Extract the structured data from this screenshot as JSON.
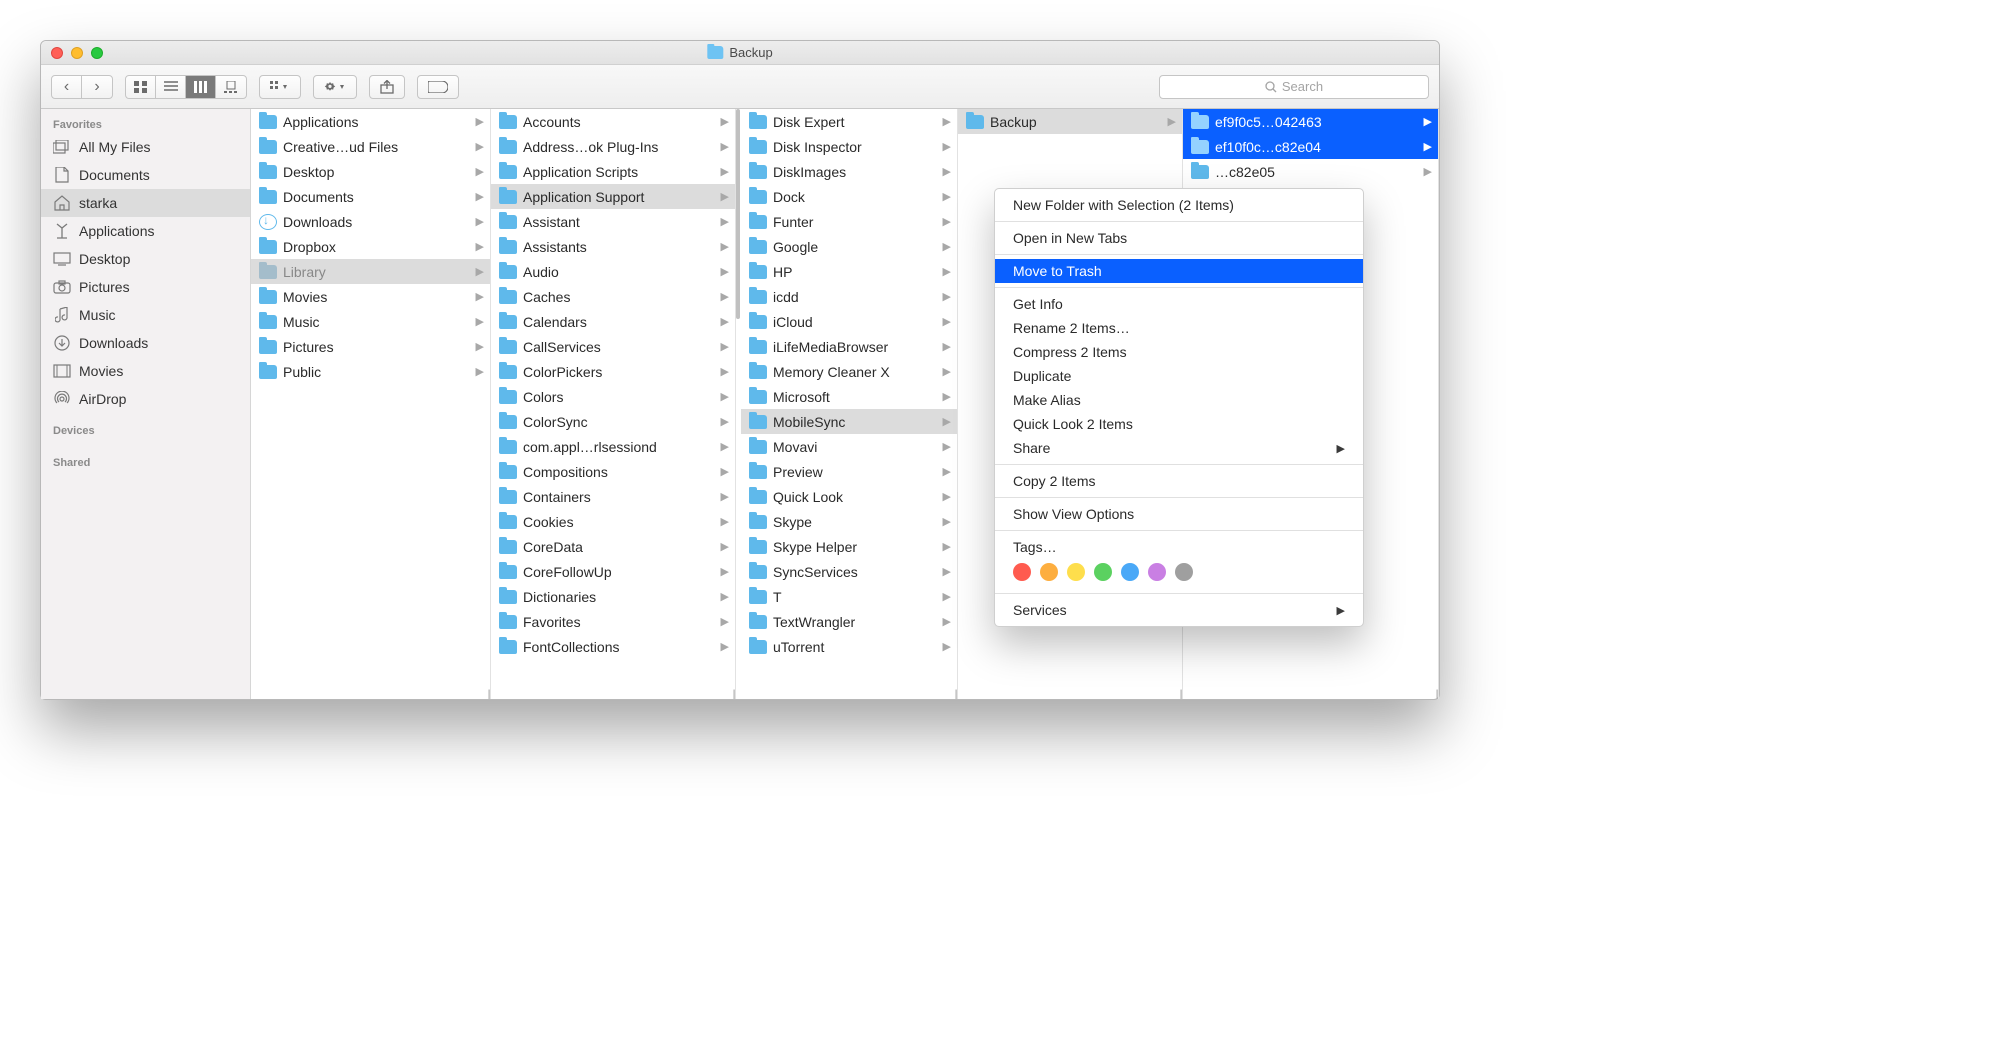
{
  "title": "Backup",
  "search_placeholder": "Search",
  "sidebar": {
    "h1": "Favorites",
    "h2": "Devices",
    "h3": "Shared",
    "items": [
      {
        "icon": "allfiles",
        "label": "All My Files"
      },
      {
        "icon": "docs",
        "label": "Documents"
      },
      {
        "icon": "home",
        "label": "starka",
        "selected": true
      },
      {
        "icon": "apps",
        "label": "Applications"
      },
      {
        "icon": "desktop",
        "label": "Desktop"
      },
      {
        "icon": "pictures",
        "label": "Pictures"
      },
      {
        "icon": "music",
        "label": "Music"
      },
      {
        "icon": "downloads",
        "label": "Downloads"
      },
      {
        "icon": "movies",
        "label": "Movies"
      },
      {
        "icon": "airdrop",
        "label": "AirDrop"
      }
    ]
  },
  "col1": [
    {
      "label": "Applications",
      "arrow": true
    },
    {
      "label": "Creative…ud Files",
      "arrow": true
    },
    {
      "label": "Desktop",
      "arrow": true
    },
    {
      "label": "Documents",
      "arrow": true
    },
    {
      "label": "Downloads",
      "arrow": true,
      "dl": true
    },
    {
      "label": "Dropbox",
      "arrow": true
    },
    {
      "label": "Library",
      "arrow": true,
      "muted": true
    },
    {
      "label": "Movies",
      "arrow": true
    },
    {
      "label": "Music",
      "arrow": true
    },
    {
      "label": "Pictures",
      "arrow": true
    },
    {
      "label": "Public",
      "arrow": true
    }
  ],
  "col2": [
    {
      "label": "Accounts",
      "arrow": true
    },
    {
      "label": "Address…ok Plug-Ins",
      "arrow": true
    },
    {
      "label": "Application Scripts",
      "arrow": true
    },
    {
      "label": "Application Support",
      "arrow": true,
      "sel": true
    },
    {
      "label": "Assistant",
      "arrow": true
    },
    {
      "label": "Assistants",
      "arrow": true
    },
    {
      "label": "Audio",
      "arrow": true
    },
    {
      "label": "Caches",
      "arrow": true
    },
    {
      "label": "Calendars",
      "arrow": true
    },
    {
      "label": "CallServices",
      "arrow": true
    },
    {
      "label": "ColorPickers",
      "arrow": true
    },
    {
      "label": "Colors",
      "arrow": true
    },
    {
      "label": "ColorSync",
      "arrow": true
    },
    {
      "label": "com.appl…rlsessiond",
      "arrow": true
    },
    {
      "label": "Compositions",
      "arrow": true
    },
    {
      "label": "Containers",
      "arrow": true
    },
    {
      "label": "Cookies",
      "arrow": true
    },
    {
      "label": "CoreData",
      "arrow": true
    },
    {
      "label": "CoreFollowUp",
      "arrow": true
    },
    {
      "label": "Dictionaries",
      "arrow": true
    },
    {
      "label": "Favorites",
      "arrow": true
    },
    {
      "label": "FontCollections",
      "arrow": true
    }
  ],
  "col3": [
    {
      "label": "Disk Expert",
      "arrow": true
    },
    {
      "label": "Disk Inspector",
      "arrow": true
    },
    {
      "label": "DiskImages",
      "arrow": true
    },
    {
      "label": "Dock",
      "arrow": true
    },
    {
      "label": "Funter",
      "arrow": true
    },
    {
      "label": "Google",
      "arrow": true
    },
    {
      "label": "HP",
      "arrow": true
    },
    {
      "label": "icdd",
      "arrow": true
    },
    {
      "label": "iCloud",
      "arrow": true
    },
    {
      "label": "iLifeMediaBrowser",
      "arrow": true
    },
    {
      "label": "Memory Cleaner X",
      "arrow": true
    },
    {
      "label": "Microsoft",
      "arrow": true
    },
    {
      "label": "MobileSync",
      "arrow": true,
      "sel": true
    },
    {
      "label": "Movavi",
      "arrow": true
    },
    {
      "label": "Preview",
      "arrow": true
    },
    {
      "label": "Quick Look",
      "arrow": true
    },
    {
      "label": "Skype",
      "arrow": true
    },
    {
      "label": "Skype Helper",
      "arrow": true
    },
    {
      "label": "SyncServices",
      "arrow": true
    },
    {
      "label": "T",
      "arrow": true
    },
    {
      "label": "TextWrangler",
      "arrow": true
    },
    {
      "label": "uTorrent",
      "arrow": true
    }
  ],
  "col4": [
    {
      "label": "Backup",
      "arrow": true,
      "sel": true
    }
  ],
  "col5": [
    {
      "label": "ef9f0c5…042463",
      "arrow": true,
      "hl": true
    },
    {
      "label": "ef10f0c…c82e04",
      "arrow": true,
      "hl": true
    },
    {
      "label": "…c82e05",
      "arrow": true,
      "plain": true
    }
  ],
  "ctx": {
    "new_folder": "New Folder with Selection (2 Items)",
    "open_tabs": "Open in New Tabs",
    "move_trash": "Move to Trash",
    "get_info": "Get Info",
    "rename": "Rename 2 Items…",
    "compress": "Compress 2 Items",
    "duplicate": "Duplicate",
    "alias": "Make Alias",
    "quicklook": "Quick Look 2 Items",
    "share": "Share",
    "copy": "Copy 2 Items",
    "viewopts": "Show View Options",
    "tags": "Tags…",
    "services": "Services",
    "tagcolors": [
      "#ff5b4f",
      "#fdae3f",
      "#fede4c",
      "#5bd160",
      "#4aa8f7",
      "#c97fe3",
      "#9f9f9f"
    ]
  }
}
